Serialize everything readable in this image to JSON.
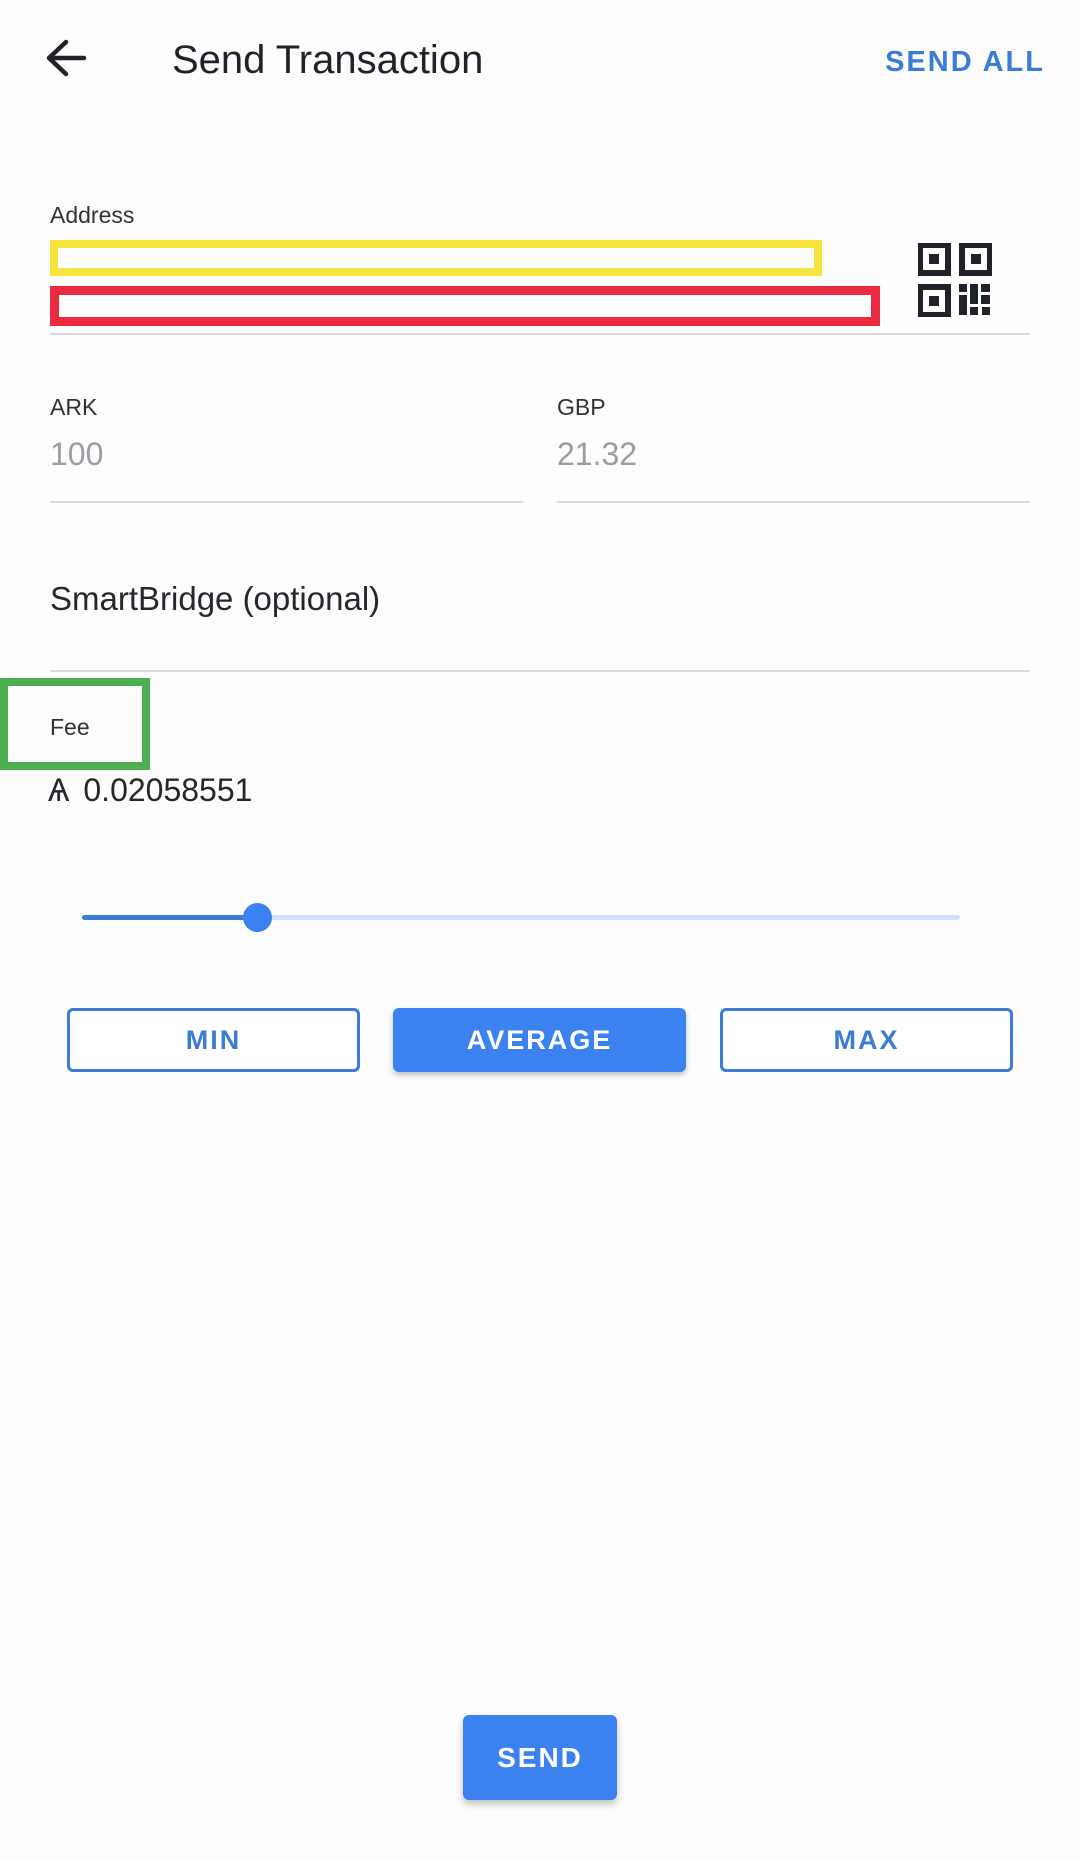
{
  "header": {
    "title": "Send Transaction",
    "send_all_label": "SEND ALL",
    "back_icon": "arrow-left-icon"
  },
  "address": {
    "label": "Address",
    "scan_icon": "qr-code-icon"
  },
  "amount": {
    "ark_label": "ARK",
    "ark_value": "100",
    "gbp_label": "GBP",
    "gbp_value": "21.32"
  },
  "smartbridge": {
    "placeholder": "SmartBridge (optional)"
  },
  "fee": {
    "label": "Fee",
    "currency_symbol": "Ѧ",
    "value": "0.02058551",
    "slider_level": 0.2,
    "buttons": {
      "min": "MIN",
      "average": "AVERAGE",
      "max": "MAX"
    },
    "selected": "average"
  },
  "send_label": "SEND",
  "colors": {
    "accent": "#3b82f0",
    "accent_text": "#3b7cd6",
    "redaction_yellow": "#f5e53c",
    "redaction_red": "#ea2a3f",
    "highlight_green": "#4caf50"
  }
}
